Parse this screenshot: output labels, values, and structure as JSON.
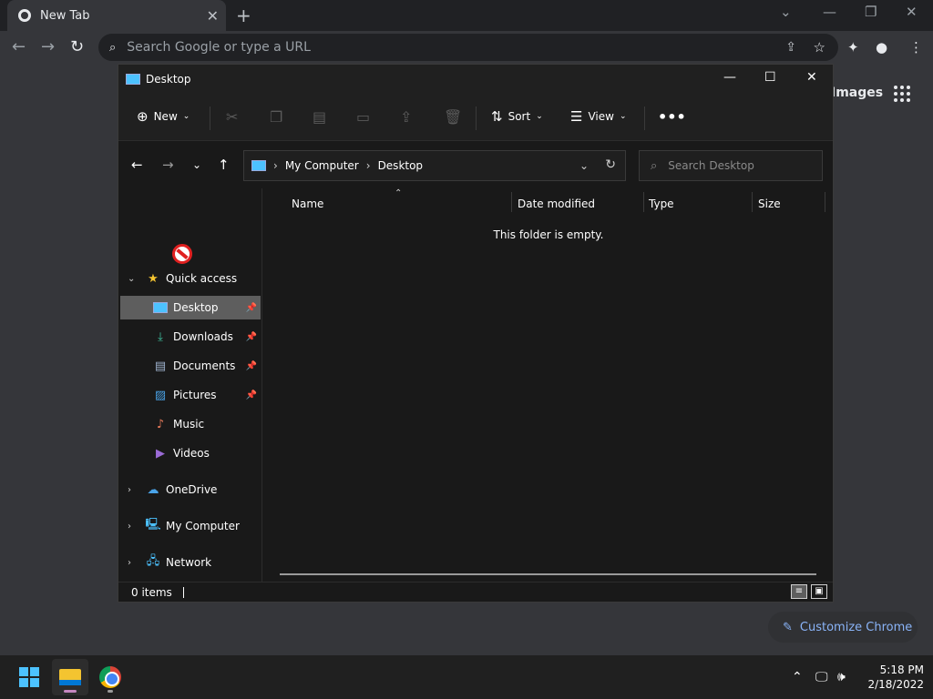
{
  "chrome": {
    "tab_title": "New Tab",
    "omnibox_placeholder": "Search Google or type a URL",
    "images_link": "Images",
    "customize_label": "Customize Chrome"
  },
  "explorer": {
    "window_title": "Desktop",
    "commands": {
      "new": "New",
      "sort": "Sort",
      "view": "View"
    },
    "breadcrumb": [
      "My Computer",
      "Desktop"
    ],
    "search_placeholder": "Search Desktop",
    "nav": {
      "quick_access": "Quick access",
      "desktop": "Desktop",
      "downloads": "Downloads",
      "documents": "Documents",
      "pictures": "Pictures",
      "music": "Music",
      "videos": "Videos",
      "onedrive": "OneDrive",
      "my_computer": "My Computer",
      "network": "Network"
    },
    "columns": {
      "name": "Name",
      "date_modified": "Date modified",
      "type": "Type",
      "size": "Size"
    },
    "empty_message": "This folder is empty.",
    "status": "0 items"
  },
  "taskbar": {
    "time": "5:18 PM",
    "date": "2/18/2022"
  },
  "colors": {
    "accent": "#4cc2ff",
    "selection": "#5e5e5e",
    "link": "#8ab4f8"
  }
}
